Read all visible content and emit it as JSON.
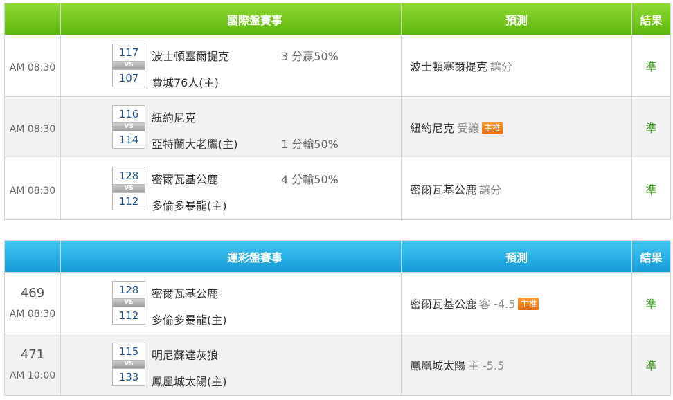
{
  "sections": [
    {
      "header": {
        "match": "國際盤賽事",
        "prediction": "預測",
        "result": "結果"
      },
      "games": [
        {
          "number": "",
          "time": "AM 08:30",
          "away": {
            "score": "117",
            "name": "波士頓塞爾提克"
          },
          "vs": "VS",
          "home": {
            "score": "107",
            "name": "費城76人(主)"
          },
          "handicap_top": "3 分贏50%",
          "handicap_bottom": "",
          "pick": "波士頓塞爾提克",
          "pick_type": "讓分",
          "badge": "",
          "result": "準"
        },
        {
          "number": "",
          "time": "AM 08:30",
          "away": {
            "score": "116",
            "name": "紐約尼克"
          },
          "vs": "VS",
          "home": {
            "score": "114",
            "name": "亞特蘭大老鷹(主)"
          },
          "handicap_top": "",
          "handicap_bottom": "1 分輸50%",
          "pick": "紐約尼克",
          "pick_type": "受讓",
          "badge": "主推",
          "result": "準"
        },
        {
          "number": "",
          "time": "AM 08:30",
          "away": {
            "score": "128",
            "name": "密爾瓦基公鹿"
          },
          "vs": "VS",
          "home": {
            "score": "112",
            "name": "多倫多暴龍(主)"
          },
          "handicap_top": "4 分輸50%",
          "handicap_bottom": "",
          "pick": "密爾瓦基公鹿",
          "pick_type": "讓分",
          "badge": "",
          "result": "準"
        }
      ]
    },
    {
      "header": {
        "match": "運彩盤賽事",
        "prediction": "預測",
        "result": "結果"
      },
      "games": [
        {
          "number": "469",
          "time": "AM 08:30",
          "away": {
            "score": "128",
            "name": "密爾瓦基公鹿"
          },
          "vs": "VS",
          "home": {
            "score": "112",
            "name": "多倫多暴龍(主)"
          },
          "handicap_top": "",
          "handicap_bottom": "",
          "pick": "密爾瓦基公鹿",
          "pick_type": "客 -4.5",
          "badge": "主推",
          "result": "準"
        },
        {
          "number": "471",
          "time": "AM 10:00",
          "away": {
            "score": "115",
            "name": "明尼蘇達灰狼"
          },
          "vs": "VS",
          "home": {
            "score": "133",
            "name": "鳳凰城太陽(主)"
          },
          "handicap_top": "",
          "handicap_bottom": "",
          "pick": "鳳凰城太陽",
          "pick_type": "主 -5.5",
          "badge": "",
          "result": "準"
        }
      ]
    }
  ],
  "colors": {
    "header_green": "#5cb50c",
    "header_blue": "#159ad8",
    "badge_orange": "#f06a06",
    "result_green": "#3a9a1a",
    "score_blue": "#1b4f8c"
  }
}
